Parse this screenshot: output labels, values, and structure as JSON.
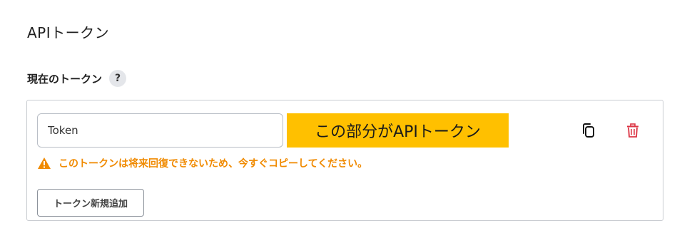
{
  "section": {
    "title": "APIトークン"
  },
  "token": {
    "label": "現在のトークン",
    "help_symbol": "?",
    "input_value": "Token",
    "callout_text": "この部分がAPIトークン",
    "callout_color": "#ffc000",
    "warning_text": "このトークンは将来回復できないため、今すぐコピーしてください。",
    "warning_color": "#f08a00",
    "add_button_label": "トークン新規追加",
    "copy_icon": "copy-icon",
    "delete_icon": "trash-icon",
    "delete_color": "#dc3545"
  }
}
